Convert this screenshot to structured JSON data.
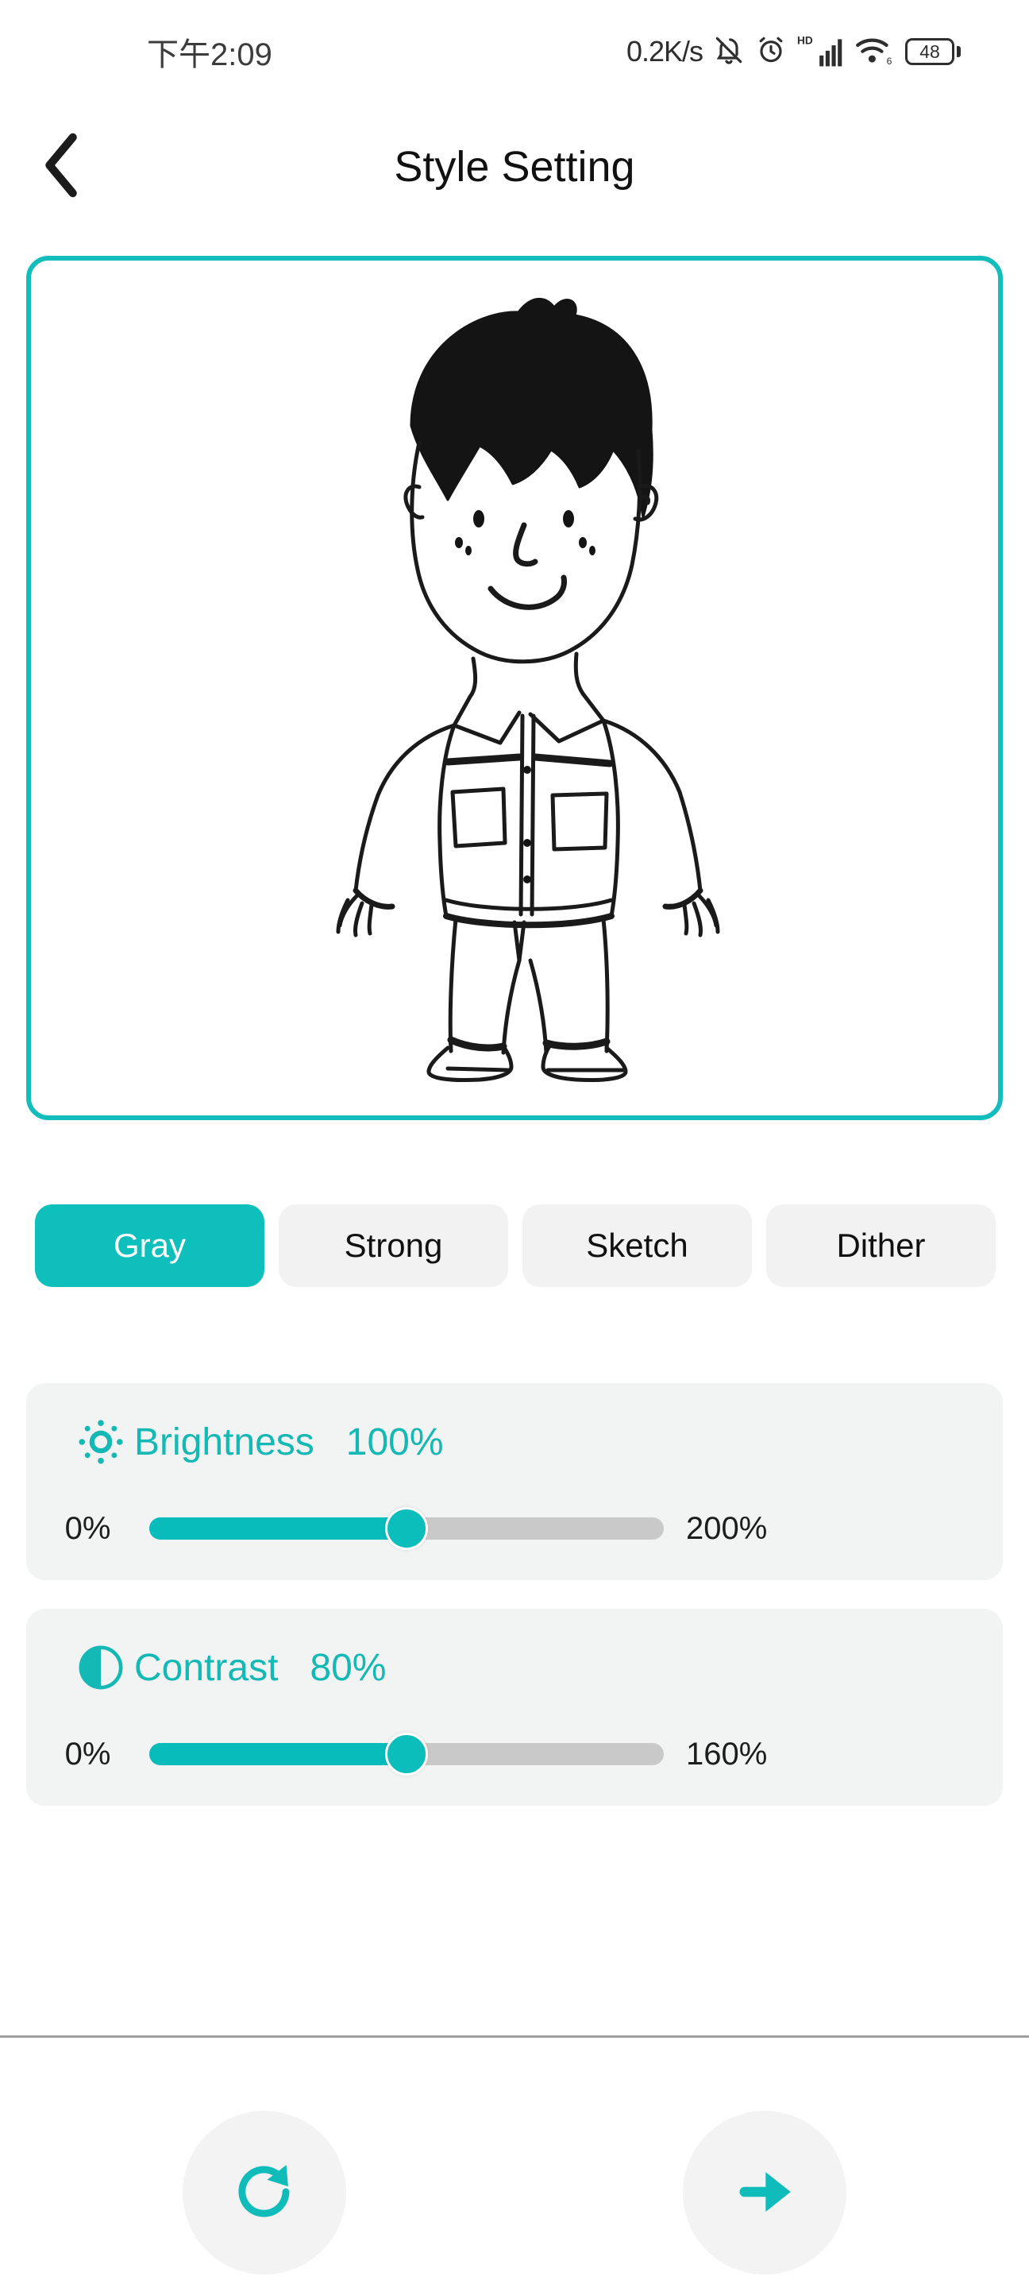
{
  "status_bar": {
    "time": "下午2:09",
    "net_speed": "0.2K/s",
    "icons": [
      "bell-off-icon",
      "alarm-clock-icon",
      "hd-signal-icon",
      "wifi-6-icon"
    ],
    "battery_level": "48"
  },
  "header": {
    "back_icon": "chevron-left-icon",
    "title": "Style Setting"
  },
  "preview": {
    "border_color": "#12bdbc",
    "image_alt": "sketch-drawing-of-boy"
  },
  "styles": {
    "selected": "Gray",
    "options": [
      {
        "label": "Gray",
        "selected": true
      },
      {
        "label": "Strong",
        "selected": false
      },
      {
        "label": "Sketch",
        "selected": false
      },
      {
        "label": "Dither",
        "selected": false
      }
    ]
  },
  "sliders": [
    {
      "id": "brightness",
      "icon": "sun-icon",
      "label": "Brightness",
      "value_text": "100%",
      "min_text": "0%",
      "max_text": "200%",
      "min": 0,
      "max": 200,
      "value": 100,
      "fill_percent": 50
    },
    {
      "id": "contrast",
      "icon": "contrast-icon",
      "label": "Contrast",
      "value_text": "80%",
      "min_text": "0%",
      "max_text": "160%",
      "min": 0,
      "max": 160,
      "value": 80,
      "fill_percent": 50
    }
  ],
  "bottom_bar": {
    "reset_icon": "refresh-icon",
    "next_icon": "arrow-right-icon"
  },
  "colors": {
    "accent": "#0fbfbc",
    "accent_text": "#14b8b4",
    "card_bg": "#f2f3f3",
    "chip_bg": "#f2f2f2",
    "track_bg": "#c9c9c9",
    "text_dark": "#111111"
  }
}
